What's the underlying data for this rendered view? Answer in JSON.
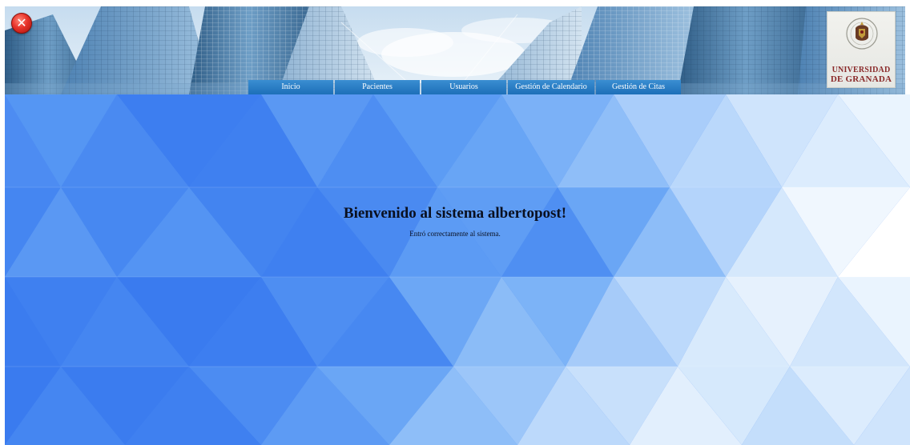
{
  "header": {
    "close_icon": "close-icon",
    "logo": {
      "line1": "UNIVERSIDAD",
      "line2": "DE GRANADA"
    }
  },
  "nav": {
    "items": [
      {
        "label": "Inicio"
      },
      {
        "label": "Pacientes"
      },
      {
        "label": "Usuarios"
      },
      {
        "label": "Gestión de Calendario"
      },
      {
        "label": "Gestión de Citas"
      }
    ]
  },
  "main": {
    "welcome": "Bienvenido al sistema albertopost!",
    "message": "Entró correctamente al sistema."
  },
  "colors": {
    "nav_bg": "#1d6fb8",
    "main_bg": "#4a8af0",
    "close_red": "#e8332a",
    "logo_text": "#8a2a2a"
  }
}
